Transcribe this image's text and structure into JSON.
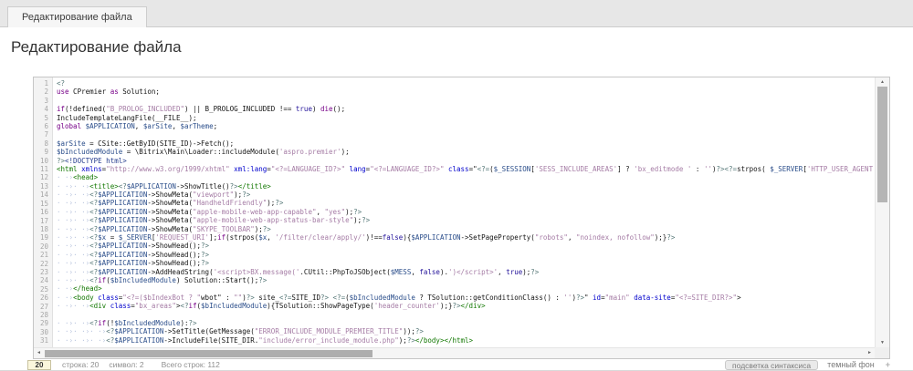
{
  "tab": {
    "label": "Редактирование файла"
  },
  "page": {
    "title": "Редактирование файла"
  },
  "icons": {
    "up": "▲",
    "down": "▼",
    "left": "◄",
    "right": "►",
    "fullscreen": "+"
  },
  "editor": {
    "lines": [
      "<?",
      "use CPremier as Solution;",
      "",
      "if(!defined(\"B_PROLOG_INCLUDED\") || B_PROLOG_INCLUDED !== true) die();",
      "IncludeTemplateLangFile(__FILE__);",
      "global $APPLICATION, $arSite, $arTheme;",
      "",
      "$arSite = CSite::GetByID(SITE_ID)->Fetch();",
      "$bIncludedModule = \\Bitrix\\Main\\Loader::includeModule('aspro.premier');",
      "?><!DOCTYPE html>",
      "<html xmlns=\"http://www.w3.org/1999/xhtml\" xml:lang=\"<?=LANGUAGE_ID?>\" lang=\"<?=LANGUAGE_ID?>\" class=\"<?=($_SESSION['SESS_INCLUDE_AREAS'] ? 'bx_editmode ' : '')?><?=strpos( $_SERVER['HTTP_USER_AGENT']",
      "\t<head>",
      "\t\t<title><?$APPLICATION->ShowTitle()?></title>",
      "\t\t<?$APPLICATION->ShowMeta(\"viewport\");?>",
      "\t\t<?$APPLICATION->ShowMeta(\"HandheldFriendly\");?>",
      "\t\t<?$APPLICATION->ShowMeta(\"apple-mobile-web-app-capable\", \"yes\");?>",
      "\t\t<?$APPLICATION->ShowMeta(\"apple-mobile-web-app-status-bar-style\");?>",
      "\t\t<?$APPLICATION->ShowMeta(\"SKYPE_TOOLBAR\");?>",
      "\t\t<?$x = $_SERVER['REQUEST_URI'];if(strpos($x, '/filter/clear/apply/')!==false){$APPLICATION->SetPageProperty(\"robots\", \"noindex, nofollow\");}?>",
      "\t\t<?$APPLICATION->ShowHead();?>",
      "\t\t<?$APPLICATION->ShowHead();?>",
      "\t\t<?$APPLICATION->ShowHead();?>",
      "\t\t<?$APPLICATION->AddHeadString('<script>BX.message('.CUtil::PhpToJSObject($MESS, false).')</script>', true);?>",
      "\t\t<?if($bIncludedModule) Solution::Start();?>",
      "\t</head>",
      "\t<body class=\"<?=($bIndexBot ? \"wbot\" : \"\")?> site_<?=SITE_ID?> <?=($bIncludedModule ? TSolution::getConditionClass() : '')?>\" id=\"main\" data-site=\"<?=SITE_DIR?>\">",
      "\t\t<div class=\"bx_areas\"><?if($bIncludedModule){TSolution::ShowPageType('header_counter');}?></div>",
      "",
      "\t\t<?if(!$bIncludedModule):?>",
      "\t\t\t<?$APPLICATION->SetTitle(GetMessage(\"ERROR_INCLUDE_MODULE_PREMIER_TITLE\"));?>",
      "\t\t\t<?$APPLICATION->IncludeFile(SITE_DIR.\"include/error_include_module.php\");?></body></html>"
    ],
    "status": {
      "goto_value": "20",
      "line_label": "строка: 20",
      "char_label": "символ: 2",
      "total_label": "Всего строк: 112",
      "syntax_label": "подсветка синтаксиса",
      "dark_label": "темный фон"
    }
  }
}
